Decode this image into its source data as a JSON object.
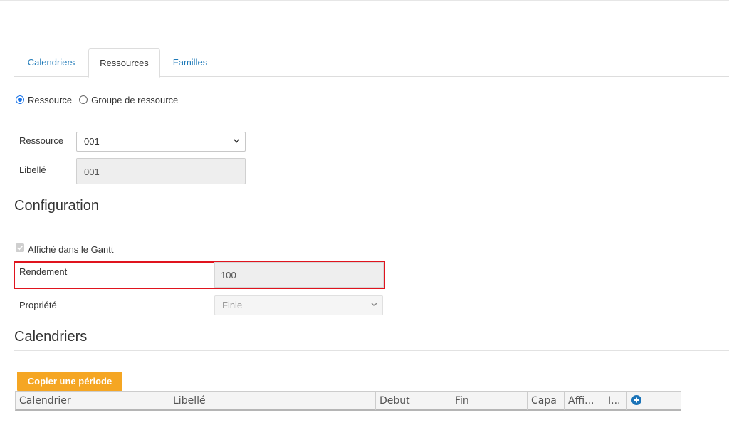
{
  "tabs": [
    {
      "label": "Calendriers"
    },
    {
      "label": "Ressources"
    },
    {
      "label": "Familles"
    }
  ],
  "radios": {
    "ressource": "Ressource",
    "groupe": "Groupe de ressource",
    "selected": "Ressource"
  },
  "form": {
    "ressource_label": "Ressource",
    "ressource_value": "001",
    "libelle_label": "Libellé",
    "libelle_value": "001"
  },
  "configuration": {
    "title": "Configuration",
    "affiche_label": "Affiché dans le Gantt",
    "affiche_checked": true,
    "rendement_label": "Rendement",
    "rendement_value": "100",
    "propriete_label": "Propriété",
    "propriete_value": "Finie"
  },
  "calendriers": {
    "title": "Calendriers",
    "copy_button": "Copier une période",
    "columns": [
      "Calendrier",
      "Libellé",
      "Debut",
      "Fin",
      "Capa",
      "Affi...",
      "I..."
    ]
  },
  "colors": {
    "accent": "#1f7ab8",
    "button": "#f5a623",
    "highlight": "#e0141e"
  }
}
